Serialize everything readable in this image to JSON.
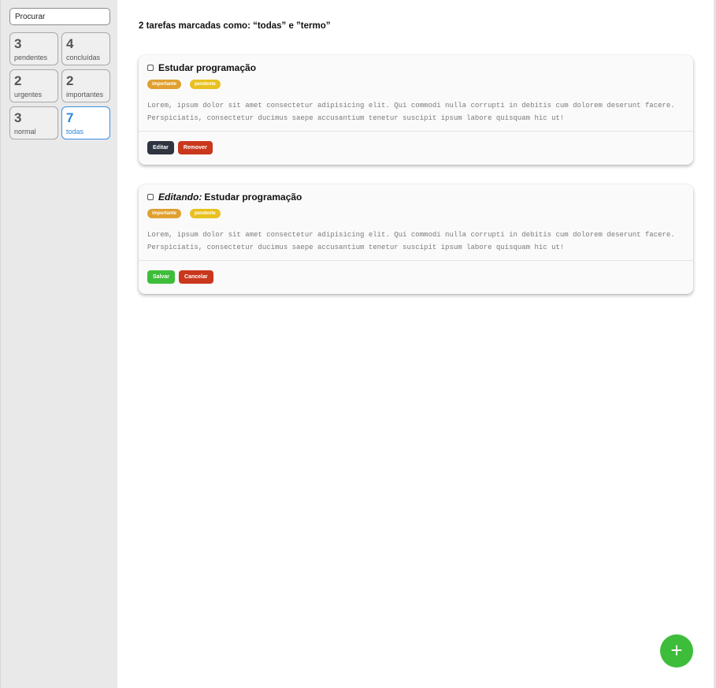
{
  "sidebar": {
    "search_placeholder": "Procurar",
    "tiles": [
      {
        "count": "3",
        "label": "pendentes"
      },
      {
        "count": "4",
        "label": "concluídas"
      },
      {
        "count": "2",
        "label": "urgentes"
      },
      {
        "count": "2",
        "label": "importantes"
      },
      {
        "count": "3",
        "label": "normal"
      },
      {
        "count": "7",
        "label": "todas"
      }
    ],
    "active_tile": "todas"
  },
  "main": {
    "heading": "2 tarefas marcadas como: “todas” e ”termo”",
    "cards": [
      {
        "editing_prefix": "",
        "title": "Estudar programação",
        "badges": [
          "importante",
          "pendente"
        ],
        "description": "Lorem, ipsum dolor sit amet consectetur adipisicing elit. Qui commodi nulla corrupti in debitis cum dolorem deserunt facere. Perspiciatis, consectetur ducimus saepe accusantium tenetur suscipit ipsum labore quisquam hic ut!",
        "actions": [
          "Editar",
          "Remover"
        ]
      },
      {
        "editing_prefix": "Editando:",
        "title": "Estudar programação",
        "badges": [
          "importante",
          "pendente"
        ],
        "description": "Lorem, ipsum dolor sit amet consectetur adipisicing elit. Qui commodi nulla corrupti in debitis cum dolorem deserunt facere. Perspiciatis, consectetur ducimus saepe accusantium tenetur suscipit ipsum labore quisquam hic ut!",
        "actions": [
          "Salvar",
          "Cancelar"
        ]
      }
    ]
  },
  "fab": {
    "label": "+",
    "icon": "plus-icon"
  },
  "colors": {
    "accent_blue": "#2d86df",
    "green": "#3ebd3a",
    "red": "#c9381d",
    "dark": "#2e3440",
    "badge_importante": "#e0a030",
    "badge_pendente": "#e8c020"
  }
}
